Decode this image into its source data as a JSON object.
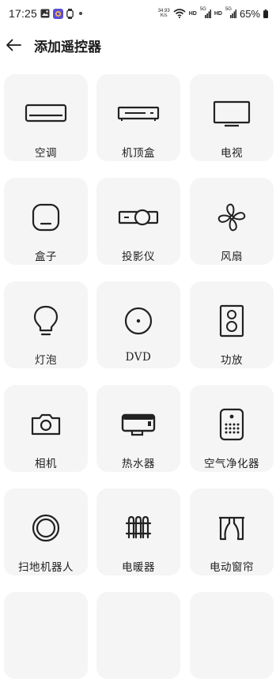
{
  "status_bar": {
    "time": "17:25",
    "speed_top": "34.93",
    "speed_bottom": "K/s",
    "hd1": "HD",
    "net1": "5G",
    "hd2": "HD",
    "net2": "5G",
    "battery": "65%"
  },
  "header": {
    "title": "添加遥控器"
  },
  "devices": [
    {
      "label": "空调",
      "icon": "air-conditioner-icon"
    },
    {
      "label": "机顶盒",
      "icon": "set-top-box-icon"
    },
    {
      "label": "电视",
      "icon": "tv-icon"
    },
    {
      "label": "盒子",
      "icon": "box-icon"
    },
    {
      "label": "投影仪",
      "icon": "projector-icon"
    },
    {
      "label": "风扇",
      "icon": "fan-icon"
    },
    {
      "label": "灯泡",
      "icon": "light-bulb-icon"
    },
    {
      "label": "DVD",
      "icon": "dvd-icon"
    },
    {
      "label": "功放",
      "icon": "amplifier-speaker-icon"
    },
    {
      "label": "相机",
      "icon": "camera-icon"
    },
    {
      "label": "热水器",
      "icon": "water-heater-icon"
    },
    {
      "label": "空气净化器",
      "icon": "air-purifier-icon"
    },
    {
      "label": "扫地机器人",
      "icon": "robot-vacuum-icon"
    },
    {
      "label": "电暖器",
      "icon": "electric-heater-icon"
    },
    {
      "label": "电动窗帘",
      "icon": "electric-curtain-icon"
    }
  ]
}
